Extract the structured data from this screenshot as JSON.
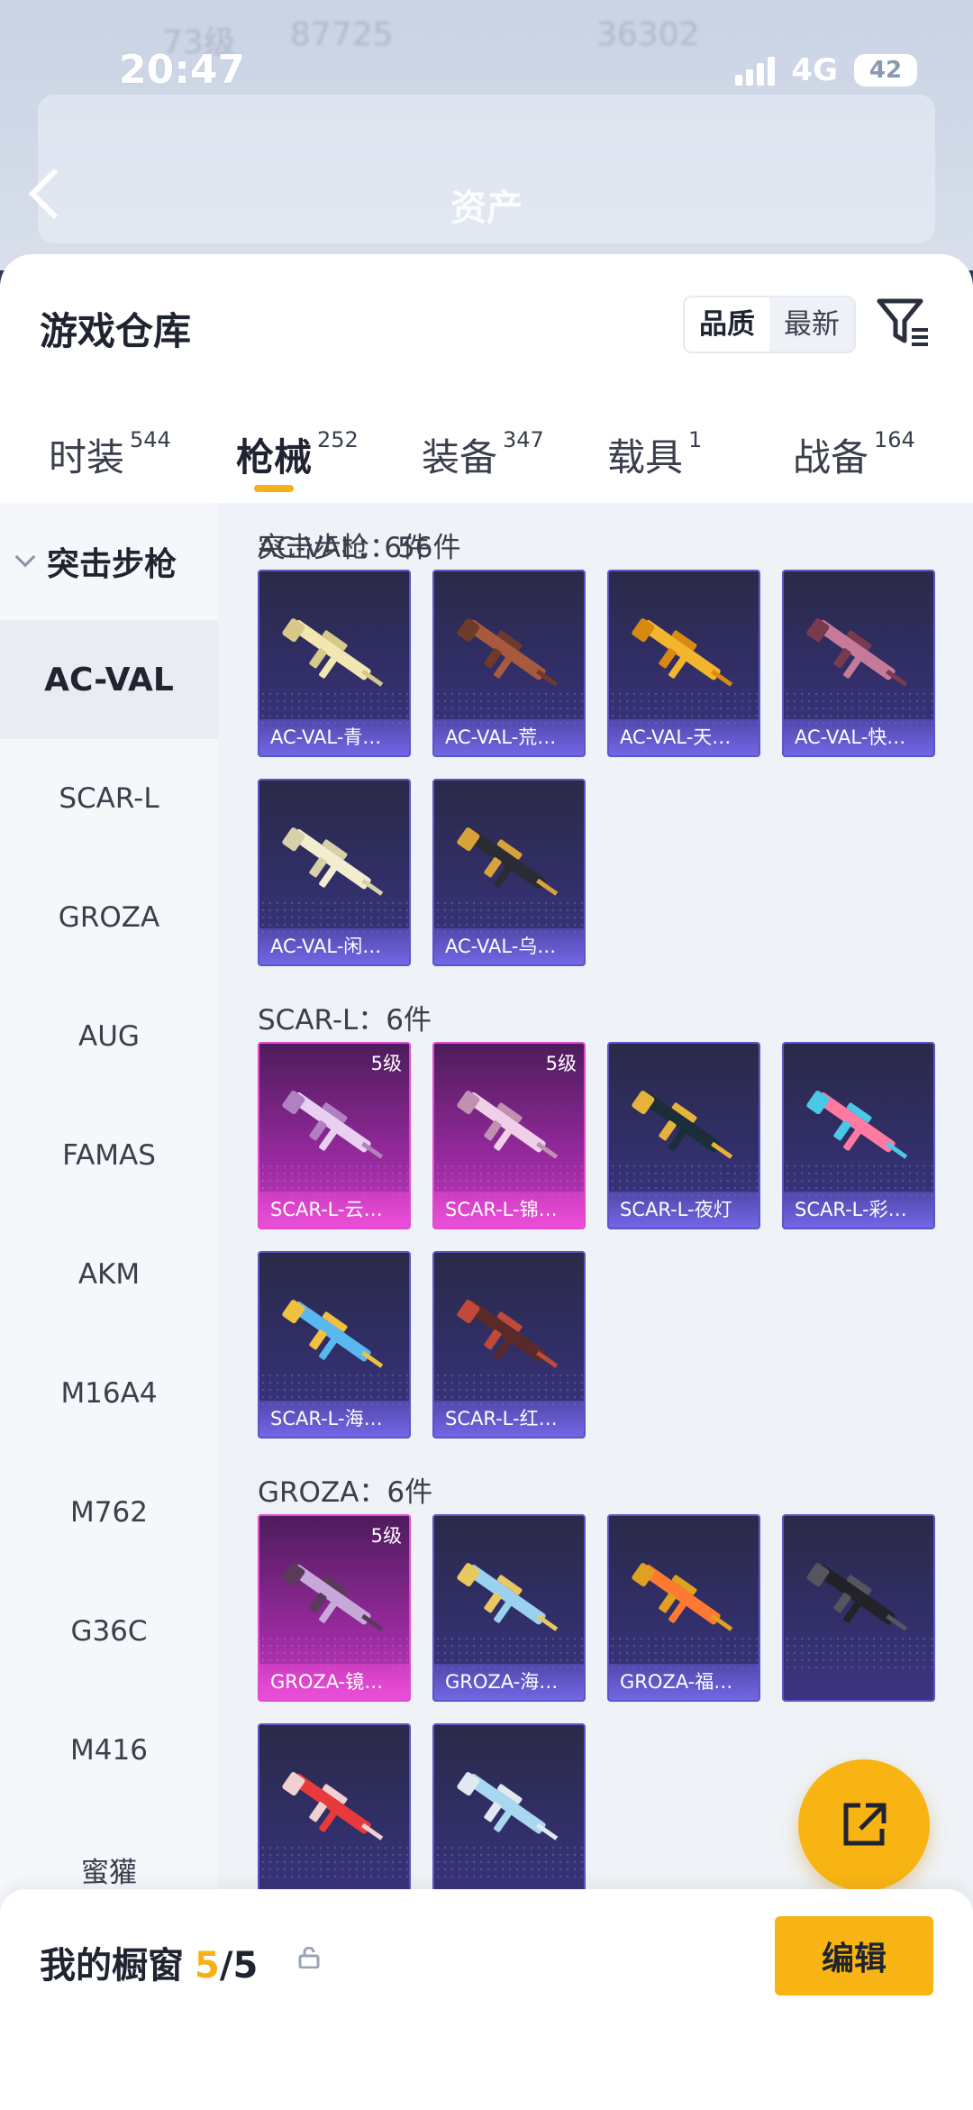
{
  "status_bar": {
    "time": "20:47",
    "network": "4G",
    "battery": "42"
  },
  "background_header": {
    "title": "资产",
    "ghost_level": "73级",
    "ghost_coins": "87725",
    "ghost_points": "36302"
  },
  "sheet": {
    "title": "游戏仓库",
    "sort_options": [
      "品质",
      "最新"
    ],
    "active_sort": "品质"
  },
  "tabs": [
    {
      "label": "时装",
      "count": "544"
    },
    {
      "label": "枪械",
      "count": "252",
      "active": true
    },
    {
      "label": "装备",
      "count": "347"
    },
    {
      "label": "载具",
      "count": "1"
    },
    {
      "label": "战备",
      "count": "164"
    }
  ],
  "sidebar": {
    "group": "突击步枪",
    "items": [
      "AC-VAL",
      "SCAR-L",
      "GROZA",
      "AUG",
      "FAMAS",
      "AKM",
      "M16A4",
      "M762",
      "G36C",
      "M416",
      "蜜獾"
    ],
    "active": "AC-VAL"
  },
  "content": {
    "section_total": "突击步枪：56件",
    "groups": [
      {
        "title": "AC-VAL：6件",
        "items": [
          {
            "name": "AC-VAL-青…",
            "tier": ""
          },
          {
            "name": "AC-VAL-荒…",
            "tier": ""
          },
          {
            "name": "AC-VAL-天…",
            "tier": ""
          },
          {
            "name": "AC-VAL-快…",
            "tier": ""
          },
          {
            "name": "AC-VAL-闲…",
            "tier": ""
          },
          {
            "name": "AC-VAL-乌…",
            "tier": ""
          }
        ]
      },
      {
        "title": "SCAR-L：6件",
        "items": [
          {
            "name": "SCAR-L-云…",
            "tier": "5级"
          },
          {
            "name": "SCAR-L-锦…",
            "tier": "5级"
          },
          {
            "name": "SCAR-L-夜灯",
            "tier": ""
          },
          {
            "name": "SCAR-L-彩…",
            "tier": ""
          },
          {
            "name": "SCAR-L-海…",
            "tier": ""
          },
          {
            "name": "SCAR-L-红…",
            "tier": ""
          }
        ]
      },
      {
        "title": "GROZA：6件",
        "items": [
          {
            "name": "GROZA-镜…",
            "tier": "5级"
          },
          {
            "name": "GROZA-海…",
            "tier": ""
          },
          {
            "name": "GROZA-福…",
            "tier": ""
          },
          {
            "name": "",
            "tier": ""
          },
          {
            "name": "",
            "tier": ""
          },
          {
            "name": "",
            "tier": ""
          }
        ]
      }
    ]
  },
  "showcase": {
    "title": "我的橱窗",
    "current": "5",
    "total": "/5",
    "edit_label": "编辑"
  },
  "icons": {
    "filter": "filter-icon",
    "share": "share-icon",
    "lock": "lock-icon",
    "back": "back-arrow-icon"
  },
  "colors": {
    "accent": "#f8b413",
    "card_blue": "#5a55c8",
    "card_tier5": "#e04ad6"
  }
}
